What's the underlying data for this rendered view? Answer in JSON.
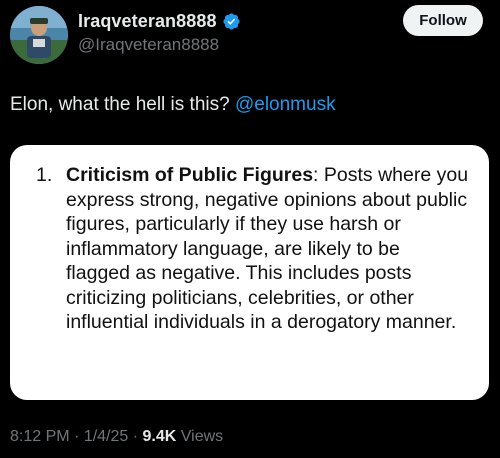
{
  "author": {
    "display_name": "Iraqveteran8888",
    "handle": "@Iraqveteran8888",
    "verified_icon": "verified-badge-icon",
    "avatar_icon": "profile-avatar"
  },
  "follow_label": "Follow",
  "tweet": {
    "text": "Elon, what the hell is this? ",
    "mention": "@elonmusk"
  },
  "card": {
    "number": "1.",
    "heading": "Criticism of Public Figures",
    "body": ": Posts where you express strong, negative opinions about public figures, particularly if they use harsh or inflammatory language, are likely to be flagged as negative. This includes posts criticizing politicians, celebrities, or other influential individuals in a derogatory manner."
  },
  "meta": {
    "time": "8:12 PM",
    "separator1": " · ",
    "date": "1/4/25",
    "separator2": " · ",
    "views_count": "9.4K",
    "views_label": " Views"
  },
  "colors": {
    "background": "#000000",
    "text": "#e7e9ea",
    "muted": "#71767b",
    "link": "#1d9bf0",
    "verified": "#1d9bf0",
    "follow_bg": "#eff3f4"
  }
}
